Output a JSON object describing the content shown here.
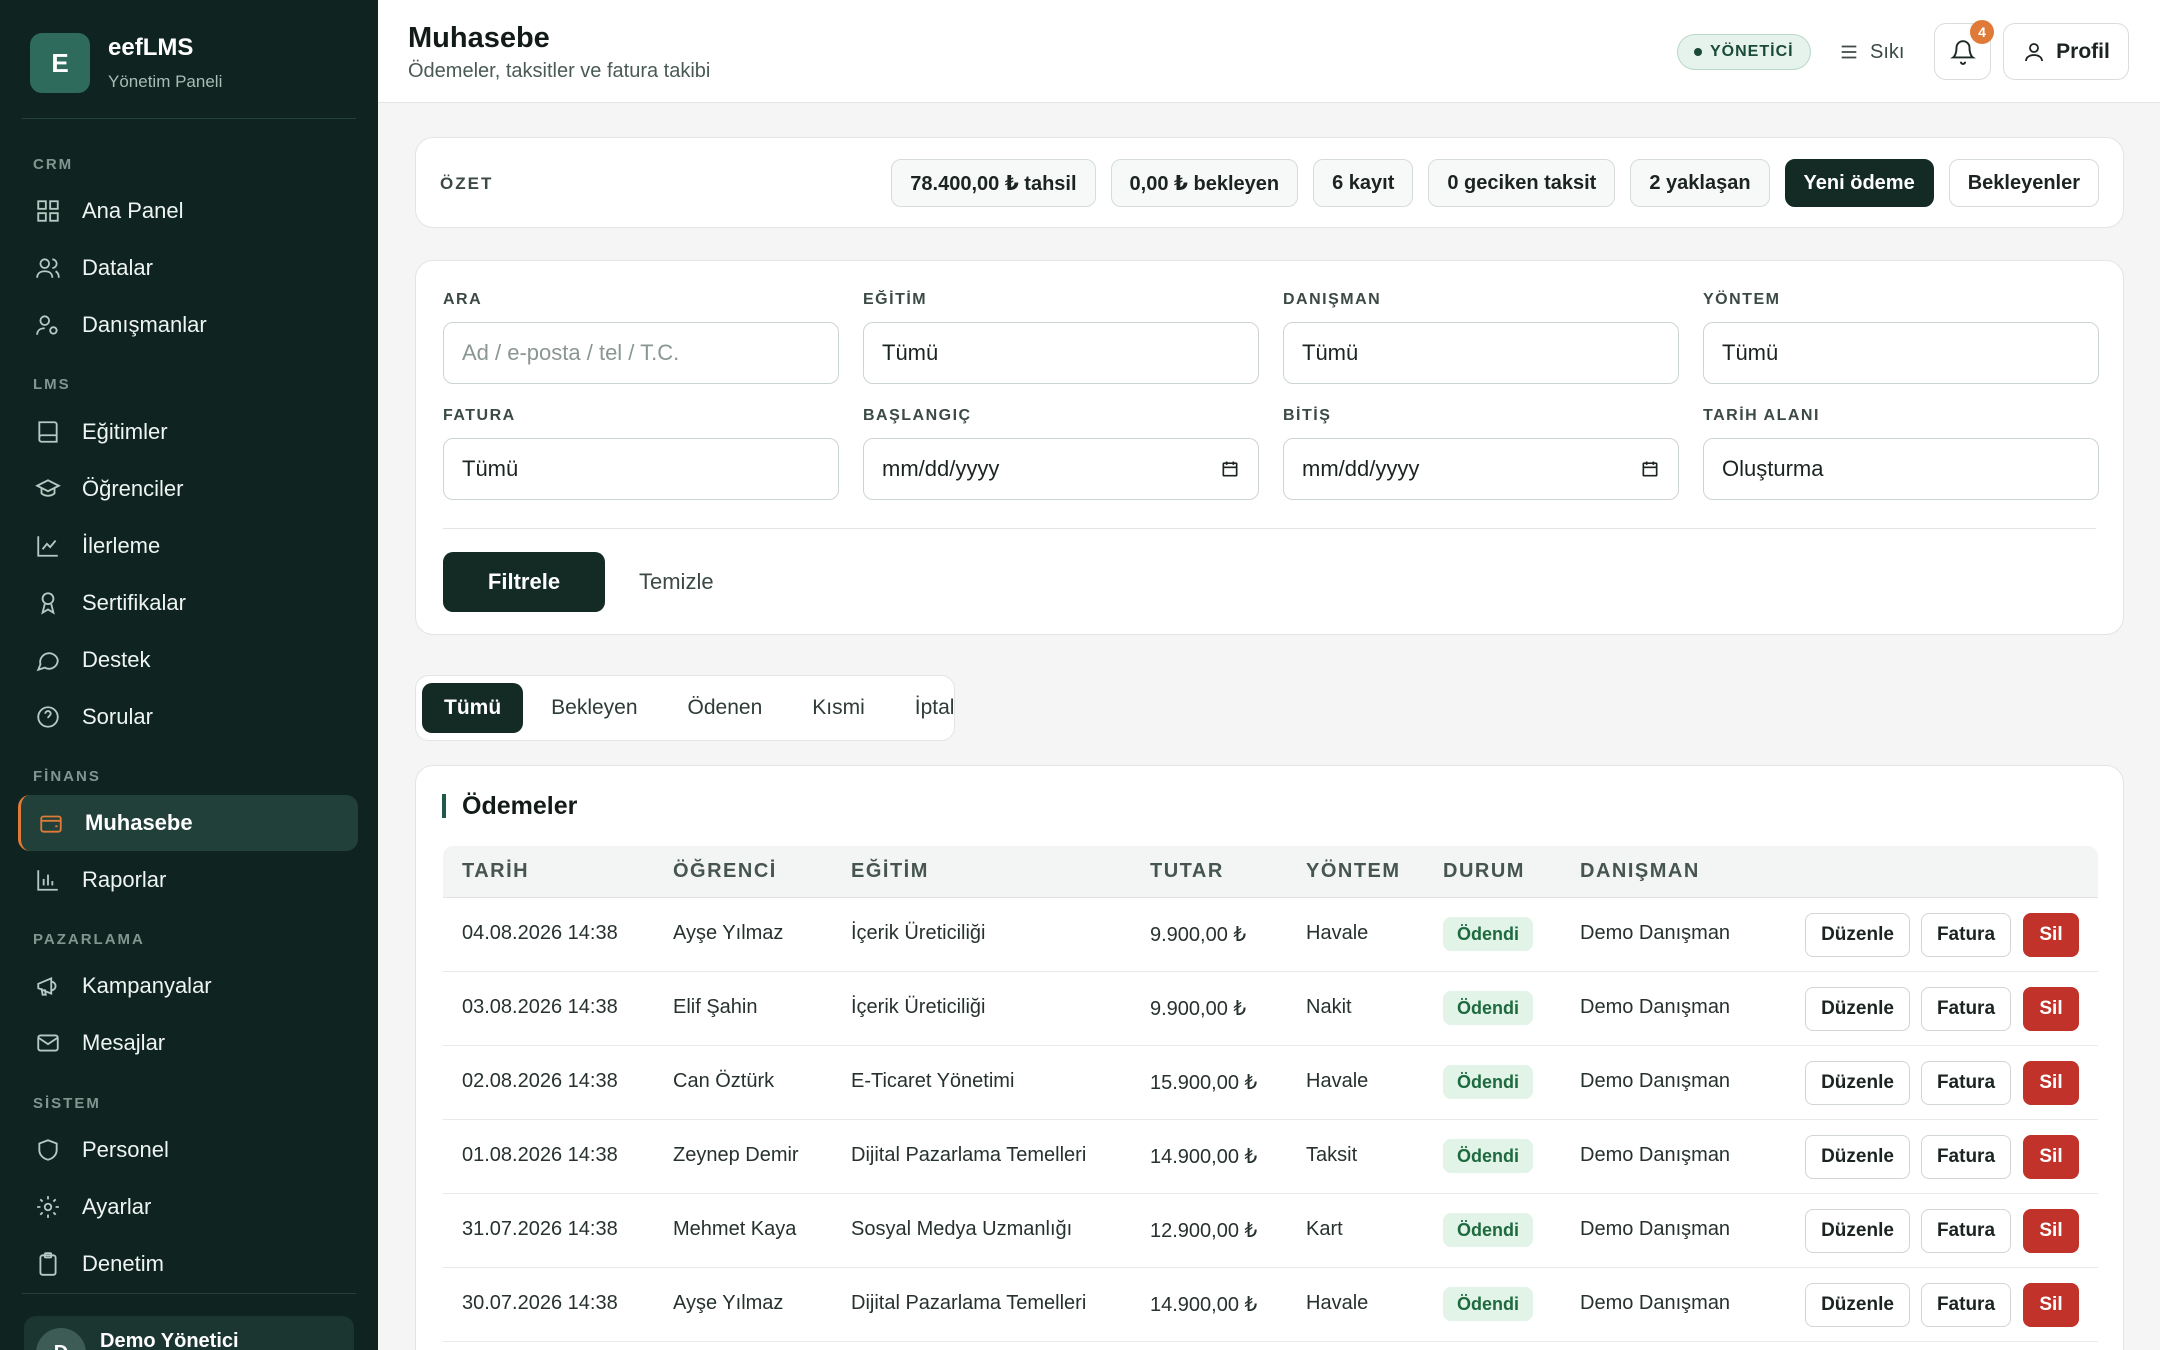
{
  "brand": {
    "logo_letter": "E",
    "name": "eefLMS",
    "subtitle": "Yönetim Paneli"
  },
  "sidebar": {
    "sections": [
      {
        "title": "CRM"
      },
      {
        "title": "LMS"
      },
      {
        "title": "FİNANS"
      },
      {
        "title": "PAZARLAMA"
      },
      {
        "title": "SİSTEM"
      }
    ],
    "items": [
      {
        "label": "Ana Panel",
        "icon": "grid-icon"
      },
      {
        "label": "Datalar",
        "icon": "users-icon"
      },
      {
        "label": "Danışmanlar",
        "icon": "user-settings-icon"
      },
      {
        "label": "Eğitimler",
        "icon": "book-icon"
      },
      {
        "label": "Öğrenciler",
        "icon": "graduation-cap-icon"
      },
      {
        "label": "İlerleme",
        "icon": "chart-line-icon"
      },
      {
        "label": "Sertifikalar",
        "icon": "award-icon"
      },
      {
        "label": "Destek",
        "icon": "chat-icon"
      },
      {
        "label": "Sorular",
        "icon": "help-circle-icon"
      },
      {
        "label": "Muhasebe",
        "icon": "wallet-icon",
        "active": true
      },
      {
        "label": "Raporlar",
        "icon": "bar-chart-icon"
      },
      {
        "label": "Kampanyalar",
        "icon": "megaphone-icon"
      },
      {
        "label": "Mesajlar",
        "icon": "mail-icon"
      },
      {
        "label": "Personel",
        "icon": "shield-icon"
      },
      {
        "label": "Ayarlar",
        "icon": "gear-icon"
      },
      {
        "label": "Denetim",
        "icon": "clipboard-icon"
      }
    ],
    "user": {
      "initial": "D",
      "name": "Demo Yönetici"
    }
  },
  "header": {
    "title": "Muhasebe",
    "subtitle": "Ödemeler, taksitler ve fatura takibi",
    "role": "YÖNETİCİ",
    "density": "Sıkı",
    "notifications": "4",
    "profile": "Profil"
  },
  "summary": {
    "label": "ÖZET",
    "chips": [
      "78.400,00 ₺ tahsil",
      "0,00 ₺ bekleyen",
      "6 kayıt",
      "0 geciken taksit",
      "2 yaklaşan"
    ],
    "new_payment": "Yeni ödeme",
    "pending": "Bekleyenler"
  },
  "filters": {
    "search": {
      "label": "ARA",
      "placeholder": "Ad / e-posta / tel / T.C."
    },
    "education": {
      "label": "EĞİTİM",
      "value": "Tümü"
    },
    "advisor": {
      "label": "DANIŞMAN",
      "value": "Tümü"
    },
    "method": {
      "label": "YÖNTEM",
      "value": "Tümü"
    },
    "invoice": {
      "label": "FATURA",
      "value": "Tümü"
    },
    "start": {
      "label": "BAŞLANGIÇ",
      "value": "mm/dd/yyyy"
    },
    "end": {
      "label": "BİTİŞ",
      "value": "mm/dd/yyyy"
    },
    "date_field": {
      "label": "TARİH ALANI",
      "value": "Oluşturma"
    },
    "apply": "Filtrele",
    "clear": "Temizle"
  },
  "tabs": [
    "Tümü",
    "Bekleyen",
    "Ödenen",
    "Kısmi",
    "İptal"
  ],
  "table": {
    "title": "Ödemeler",
    "columns": [
      "TARİH",
      "ÖĞRENCİ",
      "EĞİTİM",
      "TUTAR",
      "YÖNTEM",
      "DURUM",
      "DANIŞMAN"
    ],
    "actions": {
      "edit": "Düzenle",
      "invoice": "Fatura",
      "delete": "Sil"
    },
    "rows": [
      {
        "date": "04.08.2026 14:38",
        "student": "Ayşe Yılmaz",
        "education": "İçerik Üreticiliği",
        "amount": "9.900,00 ₺",
        "method": "Havale",
        "status": "Ödendi",
        "advisor": "Demo Danışman"
      },
      {
        "date": "03.08.2026 14:38",
        "student": "Elif Şahin",
        "education": "İçerik Üreticiliği",
        "amount": "9.900,00 ₺",
        "method": "Nakit",
        "status": "Ödendi",
        "advisor": "Demo Danışman"
      },
      {
        "date": "02.08.2026 14:38",
        "student": "Can Öztürk",
        "education": "E-Ticaret Yönetimi",
        "amount": "15.900,00 ₺",
        "method": "Havale",
        "status": "Ödendi",
        "advisor": "Demo Danışman"
      },
      {
        "date": "01.08.2026 14:38",
        "student": "Zeynep Demir",
        "education": "Dijital Pazarlama Temelleri",
        "amount": "14.900,00 ₺",
        "method": "Taksit",
        "status": "Ödendi",
        "advisor": "Demo Danışman"
      },
      {
        "date": "31.07.2026 14:38",
        "student": "Mehmet Kaya",
        "education": "Sosyal Medya Uzmanlığı",
        "amount": "12.900,00 ₺",
        "method": "Kart",
        "status": "Ödendi",
        "advisor": "Demo Danışman"
      },
      {
        "date": "30.07.2026 14:38",
        "student": "Ayşe Yılmaz",
        "education": "Dijital Pazarlama Temelleri",
        "amount": "14.900,00 ₺",
        "method": "Havale",
        "status": "Ödendi",
        "advisor": "Demo Danışman"
      }
    ]
  }
}
